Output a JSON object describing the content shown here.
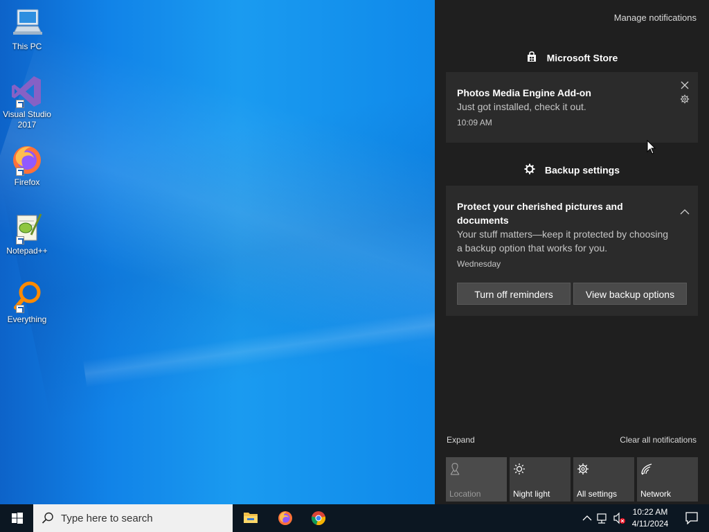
{
  "desktop": {
    "icons": [
      {
        "label": "This PC",
        "icon": "this-pc-icon"
      },
      {
        "label": "Visual Studio 2017",
        "icon": "visual-studio-icon"
      },
      {
        "label": "Firefox",
        "icon": "firefox-icon"
      },
      {
        "label": "Notepad++",
        "icon": "notepadpp-icon"
      },
      {
        "label": "Everything",
        "icon": "everything-icon"
      }
    ]
  },
  "action_center": {
    "manage_label": "Manage notifications",
    "groups": [
      {
        "app": "Microsoft Store",
        "icon": "store-icon",
        "notification": {
          "title": "Photos Media Engine Add-on",
          "body": "Just got installed, check it out.",
          "time": "10:09 AM"
        }
      },
      {
        "app": "Backup settings",
        "icon": "gear-icon",
        "notification": {
          "title": "Protect your cherished pictures and documents",
          "body": "Your stuff matters—keep it protected by choosing a backup option that works for you.",
          "time": "Wednesday",
          "buttons": [
            "Turn off reminders",
            "View backup options"
          ]
        }
      }
    ],
    "expand_label": "Expand",
    "clear_label": "Clear all notifications",
    "quick_actions": [
      {
        "label": "Location",
        "icon": "location-icon",
        "state": "off"
      },
      {
        "label": "Night light",
        "icon": "night-light-icon",
        "state": "on"
      },
      {
        "label": "All settings",
        "icon": "gear-icon",
        "state": "on"
      },
      {
        "label": "Network",
        "icon": "network-icon",
        "state": "on"
      }
    ]
  },
  "taskbar": {
    "search_placeholder": "Type here to search",
    "pinned": [
      "file-explorer-icon",
      "firefox-icon",
      "chrome-icon"
    ],
    "time": "10:22 AM",
    "date": "4/11/2024"
  },
  "colors": {
    "accent_blue": "#1183e8",
    "action_center_bg": "#1f1f1f",
    "card_bg": "#2b2b2b",
    "taskbar_bg": "#0c1722"
  }
}
